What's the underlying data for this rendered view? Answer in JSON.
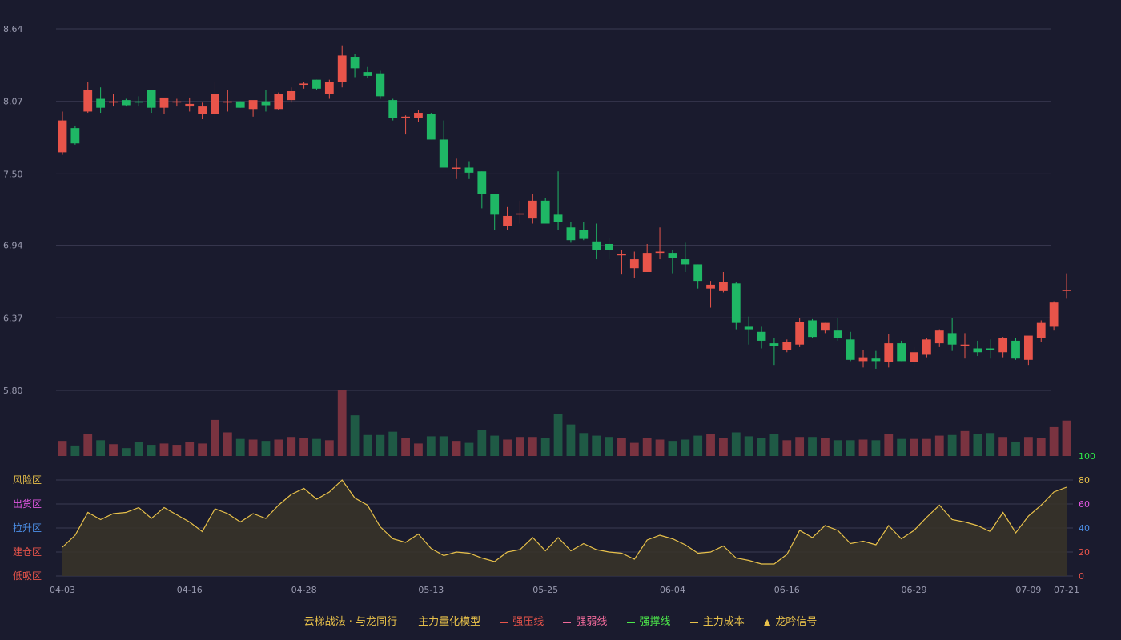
{
  "chart_data": {
    "type": "candlestick",
    "price_axis": {
      "ticks": [
        "8.64",
        "8.07",
        "7.50",
        "6.94",
        "6.37",
        "5.80"
      ],
      "min": 5.8,
      "max": 8.64
    },
    "x_ticks": [
      "04-03",
      "04-16",
      "04-28",
      "05-13",
      "05-25",
      "06-04",
      "06-16",
      "06-29",
      "07-09",
      "07-21"
    ],
    "candles": [
      {
        "o": 7.67,
        "h": 7.99,
        "l": 7.65,
        "c": 7.92
      },
      {
        "o": 7.86,
        "h": 7.88,
        "l": 7.73,
        "c": 7.74
      },
      {
        "o": 7.99,
        "h": 8.22,
        "l": 7.98,
        "c": 8.16
      },
      {
        "o": 8.09,
        "h": 8.18,
        "l": 7.98,
        "c": 8.02
      },
      {
        "o": 8.06,
        "h": 8.13,
        "l": 8.03,
        "c": 8.07
      },
      {
        "o": 8.08,
        "h": 8.09,
        "l": 8.03,
        "c": 8.04
      },
      {
        "o": 8.07,
        "h": 8.11,
        "l": 8.03,
        "c": 8.06
      },
      {
        "o": 8.16,
        "h": 8.16,
        "l": 7.98,
        "c": 8.02
      },
      {
        "o": 8.02,
        "h": 8.07,
        "l": 7.97,
        "c": 8.1
      },
      {
        "o": 8.07,
        "h": 8.09,
        "l": 8.03,
        "c": 8.07
      },
      {
        "o": 8.03,
        "h": 8.1,
        "l": 7.99,
        "c": 8.05
      },
      {
        "o": 7.97,
        "h": 8.06,
        "l": 7.93,
        "c": 8.03
      },
      {
        "o": 7.97,
        "h": 8.22,
        "l": 7.94,
        "c": 8.13
      },
      {
        "o": 8.06,
        "h": 8.16,
        "l": 7.99,
        "c": 8.07
      },
      {
        "o": 8.07,
        "h": 8.07,
        "l": 8.02,
        "c": 8.02
      },
      {
        "o": 8.01,
        "h": 8.07,
        "l": 7.95,
        "c": 8.08
      },
      {
        "o": 8.07,
        "h": 8.16,
        "l": 7.99,
        "c": 8.04
      },
      {
        "o": 8.01,
        "h": 8.14,
        "l": 8.0,
        "c": 8.13
      },
      {
        "o": 8.08,
        "h": 8.18,
        "l": 8.06,
        "c": 8.15
      },
      {
        "o": 8.2,
        "h": 8.22,
        "l": 8.17,
        "c": 8.21
      },
      {
        "o": 8.24,
        "h": 8.24,
        "l": 8.16,
        "c": 8.17
      },
      {
        "o": 8.13,
        "h": 8.24,
        "l": 8.09,
        "c": 8.22
      },
      {
        "o": 8.22,
        "h": 8.51,
        "l": 8.18,
        "c": 8.43
      },
      {
        "o": 8.42,
        "h": 8.44,
        "l": 8.26,
        "c": 8.33
      },
      {
        "o": 8.3,
        "h": 8.34,
        "l": 8.25,
        "c": 8.27
      },
      {
        "o": 8.29,
        "h": 8.31,
        "l": 8.09,
        "c": 8.11
      },
      {
        "o": 8.08,
        "h": 8.09,
        "l": 7.92,
        "c": 7.94
      },
      {
        "o": 7.95,
        "h": 7.96,
        "l": 7.81,
        "c": 7.95
      },
      {
        "o": 7.94,
        "h": 8.0,
        "l": 7.91,
        "c": 7.98
      },
      {
        "o": 7.97,
        "h": 7.98,
        "l": 7.77,
        "c": 7.77
      },
      {
        "o": 7.77,
        "h": 7.92,
        "l": 7.55,
        "c": 7.55
      },
      {
        "o": 7.55,
        "h": 7.62,
        "l": 7.46,
        "c": 7.55
      },
      {
        "o": 7.55,
        "h": 7.6,
        "l": 7.46,
        "c": 7.51
      },
      {
        "o": 7.52,
        "h": 7.52,
        "l": 7.23,
        "c": 7.34
      },
      {
        "o": 7.34,
        "h": 7.34,
        "l": 7.06,
        "c": 7.18
      },
      {
        "o": 7.09,
        "h": 7.24,
        "l": 7.06,
        "c": 7.17
      },
      {
        "o": 7.19,
        "h": 7.29,
        "l": 7.11,
        "c": 7.19
      },
      {
        "o": 7.15,
        "h": 7.34,
        "l": 7.11,
        "c": 7.29
      },
      {
        "o": 7.29,
        "h": 7.31,
        "l": 7.14,
        "c": 7.11
      },
      {
        "o": 7.18,
        "h": 7.52,
        "l": 7.06,
        "c": 7.12
      },
      {
        "o": 7.08,
        "h": 7.12,
        "l": 6.96,
        "c": 6.98
      },
      {
        "o": 7.06,
        "h": 7.12,
        "l": 6.98,
        "c": 6.99
      },
      {
        "o": 6.97,
        "h": 7.11,
        "l": 6.83,
        "c": 6.9
      },
      {
        "o": 6.95,
        "h": 7.0,
        "l": 6.83,
        "c": 6.9
      },
      {
        "o": 6.87,
        "h": 6.9,
        "l": 6.71,
        "c": 6.87
      },
      {
        "o": 6.76,
        "h": 6.89,
        "l": 6.68,
        "c": 6.83
      },
      {
        "o": 6.73,
        "h": 6.95,
        "l": 6.73,
        "c": 6.88
      },
      {
        "o": 6.88,
        "h": 7.08,
        "l": 6.83,
        "c": 6.89
      },
      {
        "o": 6.88,
        "h": 6.9,
        "l": 6.72,
        "c": 6.84
      },
      {
        "o": 6.83,
        "h": 6.96,
        "l": 6.73,
        "c": 6.79
      },
      {
        "o": 6.79,
        "h": 6.79,
        "l": 6.6,
        "c": 6.66
      },
      {
        "o": 6.6,
        "h": 6.66,
        "l": 6.45,
        "c": 6.63
      },
      {
        "o": 6.58,
        "h": 6.73,
        "l": 6.57,
        "c": 6.65
      },
      {
        "o": 6.64,
        "h": 6.65,
        "l": 6.28,
        "c": 6.33
      },
      {
        "o": 6.3,
        "h": 6.38,
        "l": 6.16,
        "c": 6.28
      },
      {
        "o": 6.26,
        "h": 6.3,
        "l": 6.13,
        "c": 6.19
      },
      {
        "o": 6.17,
        "h": 6.21,
        "l": 6.0,
        "c": 6.15
      },
      {
        "o": 6.12,
        "h": 6.2,
        "l": 6.1,
        "c": 6.18
      },
      {
        "o": 6.16,
        "h": 6.37,
        "l": 6.14,
        "c": 6.34
      },
      {
        "o": 6.35,
        "h": 6.36,
        "l": 6.21,
        "c": 6.22
      },
      {
        "o": 6.27,
        "h": 6.33,
        "l": 6.25,
        "c": 6.33
      },
      {
        "o": 6.27,
        "h": 6.37,
        "l": 6.19,
        "c": 6.21
      },
      {
        "o": 6.2,
        "h": 6.26,
        "l": 6.03,
        "c": 6.04
      },
      {
        "o": 6.03,
        "h": 6.12,
        "l": 5.98,
        "c": 6.06
      },
      {
        "o": 6.05,
        "h": 6.11,
        "l": 5.97,
        "c": 6.03
      },
      {
        "o": 6.02,
        "h": 6.24,
        "l": 5.98,
        "c": 6.17
      },
      {
        "o": 6.17,
        "h": 6.19,
        "l": 6.03,
        "c": 6.03
      },
      {
        "o": 6.02,
        "h": 6.14,
        "l": 5.98,
        "c": 6.1
      },
      {
        "o": 6.08,
        "h": 6.21,
        "l": 6.06,
        "c": 6.2
      },
      {
        "o": 6.17,
        "h": 6.28,
        "l": 6.14,
        "c": 6.27
      },
      {
        "o": 6.25,
        "h": 6.37,
        "l": 6.11,
        "c": 6.16
      },
      {
        "o": 6.16,
        "h": 6.25,
        "l": 6.05,
        "c": 6.16
      },
      {
        "o": 6.13,
        "h": 6.19,
        "l": 6.07,
        "c": 6.1
      },
      {
        "o": 6.13,
        "h": 6.2,
        "l": 6.05,
        "c": 6.12
      },
      {
        "o": 6.1,
        "h": 6.22,
        "l": 6.06,
        "c": 6.21
      },
      {
        "o": 6.19,
        "h": 6.21,
        "l": 6.04,
        "c": 6.05
      },
      {
        "o": 6.04,
        "h": 6.22,
        "l": 6.0,
        "c": 6.23
      },
      {
        "o": 6.21,
        "h": 6.35,
        "l": 6.18,
        "c": 6.33
      },
      {
        "o": 6.3,
        "h": 6.5,
        "l": 6.27,
        "c": 6.49
      },
      {
        "o": 6.59,
        "h": 6.72,
        "l": 6.52,
        "c": 6.59
      }
    ],
    "volume": [
      0.23,
      0.16,
      0.34,
      0.24,
      0.18,
      0.12,
      0.21,
      0.17,
      0.19,
      0.17,
      0.21,
      0.19,
      0.55,
      0.36,
      0.26,
      0.25,
      0.23,
      0.25,
      0.29,
      0.28,
      0.26,
      0.24,
      1.0,
      0.62,
      0.32,
      0.32,
      0.37,
      0.28,
      0.19,
      0.3,
      0.3,
      0.23,
      0.2,
      0.4,
      0.31,
      0.25,
      0.29,
      0.29,
      0.28,
      0.64,
      0.48,
      0.35,
      0.31,
      0.29,
      0.28,
      0.2,
      0.28,
      0.25,
      0.23,
      0.25,
      0.31,
      0.34,
      0.27,
      0.36,
      0.3,
      0.28,
      0.33,
      0.24,
      0.29,
      0.29,
      0.28,
      0.24,
      0.24,
      0.25,
      0.24,
      0.34,
      0.26,
      0.26,
      0.26,
      0.31,
      0.32,
      0.38,
      0.34,
      0.35,
      0.29,
      0.22,
      0.29,
      0.27,
      0.44,
      0.54
    ],
    "zones": {
      "labels": [
        "风险区",
        "出货区",
        "拉升区",
        "建仓区",
        "低吸区"
      ],
      "label_colors": [
        "#e8c14a",
        "#e056e0",
        "#4c8fe8",
        "#e8544a",
        "#e8544a"
      ]
    },
    "indicator_axis": {
      "ticks": [
        "100",
        "80",
        "60",
        "40",
        "20",
        "0"
      ],
      "tick_colors": [
        "#2ee84a",
        "#e8c14a",
        "#e056e0",
        "#4c8fe8",
        "#e8544a",
        "#e8544a"
      ]
    },
    "indicator": [
      24,
      34,
      53,
      47,
      52,
      53,
      57,
      48,
      57,
      51,
      45,
      37,
      56,
      52,
      45,
      52,
      48,
      59,
      68,
      73,
      64,
      70,
      80,
      65,
      59,
      41,
      31,
      28,
      35,
      23,
      17,
      20,
      19,
      15,
      12,
      20,
      22,
      32,
      21,
      32,
      21,
      27,
      22,
      20,
      19,
      14,
      30,
      34,
      31,
      26,
      19,
      20,
      25,
      15,
      13,
      10,
      10,
      18,
      38,
      32,
      42,
      38,
      27,
      29,
      26,
      42,
      31,
      38,
      49,
      59,
      47,
      45,
      42,
      37,
      53,
      36,
      50,
      59,
      70,
      74
    ],
    "legend": {
      "title": "云梯战法 · 与龙同行——主力量化模型",
      "items": [
        {
          "label": "强压线",
          "color": "#e8544a",
          "style": "solid"
        },
        {
          "label": "强弱线",
          "color": "#f06a9a",
          "style": "dashed"
        },
        {
          "label": "强撑线",
          "color": "#4ce84a",
          "style": "solid"
        },
        {
          "label": "主力成本",
          "color": "#e8c14a",
          "style": "dashed"
        },
        {
          "label": "龙吟信号",
          "color": "#e8c14a",
          "style": "triangle"
        }
      ]
    },
    "colors": {
      "up": "#e8544a",
      "down": "#1fb765",
      "grid": "#3a3b52",
      "axis_text": "#9a9bb0",
      "indicator_line": "#e8c14a"
    }
  }
}
